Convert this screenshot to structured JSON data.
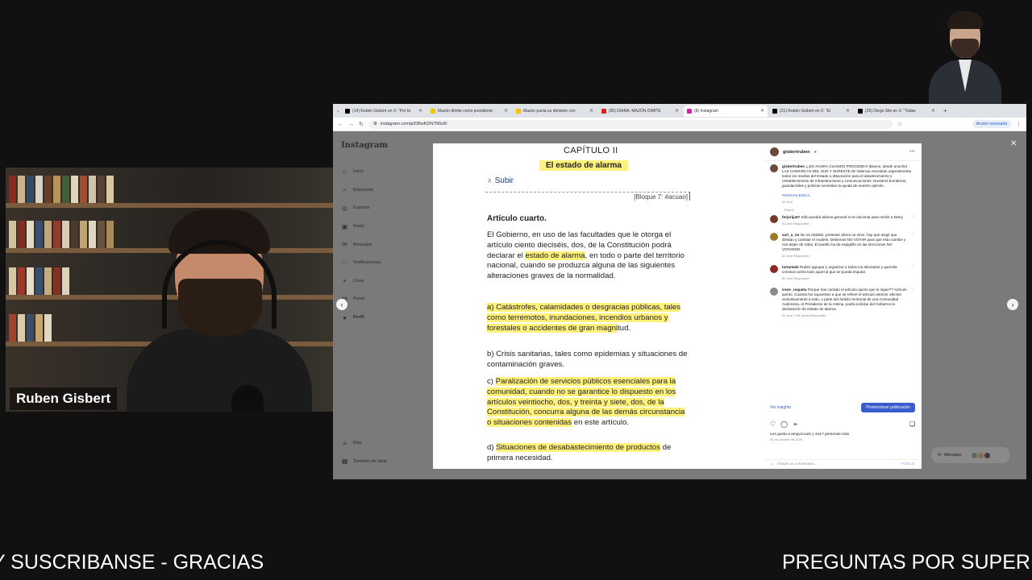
{
  "browser": {
    "tabs": [
      {
        "label": "(14) Rubén Gisbert en X: \"Por fa",
        "color": "#000000",
        "active": false
      },
      {
        "label": "Mazón dimite como presidente",
        "color": "#f4c400",
        "active": false
      },
      {
        "label": "Mazón pacta su dimisión con",
        "color": "#f4c400",
        "active": false
      },
      {
        "label": "(85) DIANA: MAZÓN DIMITE",
        "color": "#e02020",
        "active": false
      },
      {
        "label": "(8) Instagram",
        "color": "#d6249f",
        "active": true
      },
      {
        "label": "(21) Rubén Gisbert en X: \"El",
        "color": "#000000",
        "active": false
      },
      {
        "label": "(25) Diego Sile en X: \"Todas",
        "color": "#000000",
        "active": false
      }
    ],
    "url": "instagram.com/p/DBwKDN7N5v8/",
    "account_button": "Acción necesaria"
  },
  "instagram": {
    "logo": "Instagram",
    "nav": [
      {
        "icon": "home",
        "label": "Inicio"
      },
      {
        "icon": "search",
        "label": "Búsqueda"
      },
      {
        "icon": "compass",
        "label": "Explorar"
      },
      {
        "icon": "reels",
        "label": "Reels"
      },
      {
        "icon": "messages",
        "label": "Mensajes"
      },
      {
        "icon": "heart",
        "label": "Notificaciones"
      },
      {
        "icon": "plus",
        "label": "Crear"
      },
      {
        "icon": "panel",
        "label": "Panel"
      },
      {
        "icon": "profile",
        "label": "Perfil"
      }
    ],
    "more": "Más",
    "threads": "También de Meta",
    "messages_pill": "Mensajes"
  },
  "document": {
    "chapter": "CAPÍTULO II",
    "title": "El estado de alarma",
    "subir": "Subir",
    "bloque": "[Bloque 7: #acuao]",
    "article_title": "Artículo cuarto.",
    "p1_before": "El Gobierno, en uso de las facultades que le otorga el artículo ciento dieciséis, dos, de la Constitución podrá declarar el ",
    "p1_hl": "estado de alarma",
    "p1_after": ", en todo o parte del territorio nacional, cuando se produzca alguna de las siguientes alteraciones graves de la normalidad.",
    "a_hl": "a) Catástrofes, calamidades o desgracias públicas, tales como terremotos, inundaciones, incendios urbanos y forestales o accidentes de gran magni",
    "a_rest": "tud.",
    "b": "b) Crisis sanitarias, tales como epidemias y situaciones de contaminación graves.",
    "c_before": "c) ",
    "c_hl": "Paralización de servicios públicos esenciales para la comunidad, cuando no se garantice lo dispuesto en los artículos veintiocho, dos, y treinta y siete, dos, de la Constitución, concurra alguna de las demás circunstancia o situaciones contenidas",
    "c_after": " en este artículo.",
    "d_before": "d) ",
    "d_hl": "Situaciones de desabastecimiento de productos",
    "d_after": " de primera necesidad."
  },
  "post": {
    "username": "gisbertruben",
    "caption_user": "gisbertruben",
    "caption": "¡¡¡ES AHORA CUANDO PROCEDE!!! (Bueno, desde anoche) LAS COMARCAS DEL SUR Y SURESTE de Valencia necesitan urgentemente todos los medios del Estado a disposición para el abastecimiento y restablecimiento de infraestructuras y comunicaciones. Nuestros bomberos, guardaciviles y policías necesitan la ayuda de nuestro ejército.",
    "hashtag": "#SOSVALENCIA",
    "caption_meta": "52 sem",
    "hidden": "Para ti",
    "comments": [
      {
        "user": "ferjoriju67",
        "text": "Sólo pondrá alarma general si es nacional para recibir a Delcy",
        "meta": "51 sem  Responder"
      },
      {
        "user": "sari_a_nn",
        "text": "No os olvidéis, protestar ahora no sirve, hay que exigir que dimitan y cambiar el modelo. Debemos NO VOTAR para que esto cambie y nos dejen de robar. El pueblo ha de espigrillo en las elecciones NO VOTANDO",
        "meta": "52 sem  Responder"
      },
      {
        "user": "tartantale",
        "text": "Rubén agrupar y organizar a todos los afectados y querella criminal contra todo aquel al que se pueda imputar.",
        "meta": "52 sem  Responder"
      },
      {
        "user": "irene_roqueta",
        "text": "Porque has cortado el artículo quinto que le sigue?? Artículo quinto. Cuando los supuestos a que se refiere el artículo anterior afecten exclusivamente a todo, o parte del ámbito territorial de una Comunidad Autónoma, el Presidente de la misma, podrá solicitar del Gobierno la declaración de estado de alarma",
        "meta": "51 sem  1 Me gusta  Responder"
      }
    ],
    "insights": "Ver insights",
    "promote": "Promocionar publicación",
    "likes": "Les gusta a amgvcruuts y 4417 personas más",
    "date": "30 de octubre de 2024",
    "add_comment": "Añade un comentario...",
    "publish": "Publicar"
  },
  "presenter": {
    "name": "Ruben Gisbert"
  },
  "ticker": {
    "left": "Y SUSCRIBANSE - GRACIAS",
    "right": "PREGUNTAS POR SUPER"
  }
}
